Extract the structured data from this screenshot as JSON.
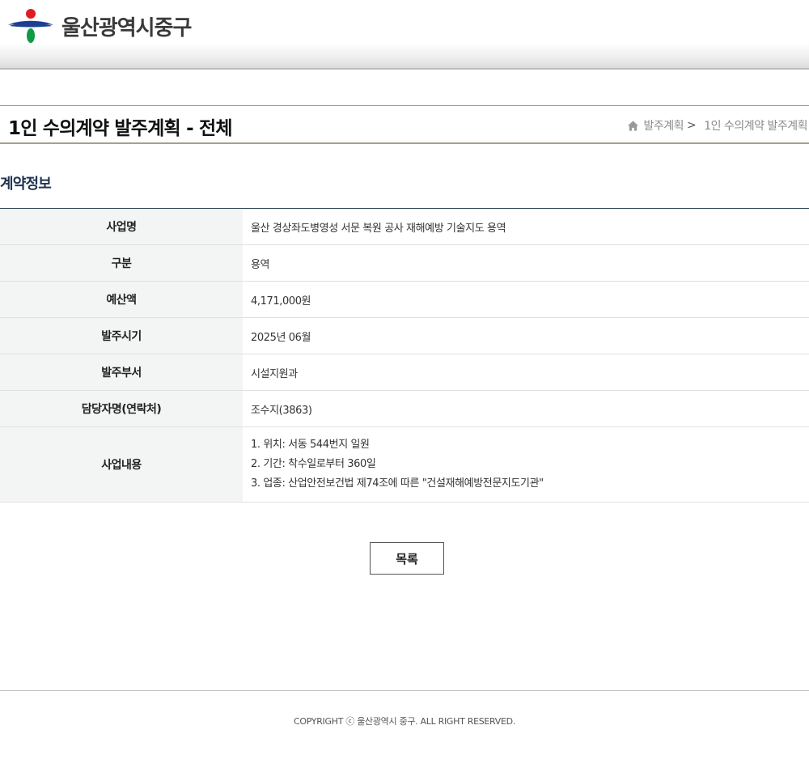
{
  "header": {
    "org_name": "울산광역시중구",
    "logo_colors": {
      "red": "#e11b22",
      "blue": "#1c3f94",
      "green": "#0f9a48"
    }
  },
  "title_bar": {
    "page_title": "1인 수의계약 발주계획 - 전체",
    "breadcrumb": {
      "home_icon": "home-icon",
      "items": [
        "발주계획",
        "1인 수의계약 발주계획"
      ],
      "separator": ">"
    }
  },
  "section": {
    "title": "계약정보"
  },
  "contract": {
    "rows": [
      {
        "label": "사업명",
        "value": "울산 경상좌도병영성 서문 복원 공사 재해예방 기술지도 용역"
      },
      {
        "label": "구분",
        "value": "용역"
      },
      {
        "label": "예산액",
        "value": "4,171,000원"
      },
      {
        "label": "발주시기",
        "value": "2025년 06월"
      },
      {
        "label": "발주부서",
        "value": "시설지원과"
      },
      {
        "label": "담당자명(연락처)",
        "value": "조수지(3863)"
      }
    ],
    "content": {
      "label": "사업내용",
      "lines": [
        "1. 위치: 서동 544번지 일원",
        "2. 기간: 착수일로부터 360일",
        "3. 업종: 산업안전보건법 제74조에 따른 \"건설재해예방전문지도기관\""
      ]
    }
  },
  "buttons": {
    "list_label": "목록"
  },
  "footer": {
    "copyright": "COPYRIGHT ⓒ 울산광역시 중구. ALL RIGHT RESERVED."
  },
  "colors": {
    "title_text": "#111111",
    "section_title": "#1f3550",
    "table_header_bg": "#f3f5f4",
    "table_top_border": "#2d4556"
  }
}
